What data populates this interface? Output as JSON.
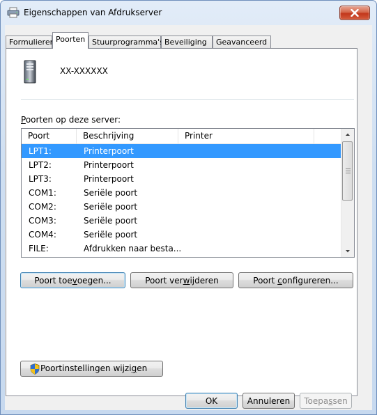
{
  "window": {
    "title": "Eigenschappen van Afdrukserver",
    "close_icon": "close-icon"
  },
  "tabs": [
    {
      "label": "Formulieren",
      "active": false
    },
    {
      "label": "Poorten",
      "active": true
    },
    {
      "label": "Stuurprogramma's",
      "active": false
    },
    {
      "label": "Beveiliging",
      "active": false
    },
    {
      "label": "Geavanceerd",
      "active": false
    }
  ],
  "server": {
    "name": "XX-XXXXXX",
    "icon": "server-icon"
  },
  "ports": {
    "label_pre": "",
    "label_underlined": "P",
    "label_post": "oorten op deze server:",
    "columns": [
      "Poort",
      "Beschrijving",
      "Printer"
    ],
    "rows": [
      {
        "port": "LPT1:",
        "description": "Printerpoort",
        "printer": "",
        "selected": true
      },
      {
        "port": "LPT2:",
        "description": "Printerpoort",
        "printer": "",
        "selected": false
      },
      {
        "port": "LPT3:",
        "description": "Printerpoort",
        "printer": "",
        "selected": false
      },
      {
        "port": "COM1:",
        "description": "Seriële poort",
        "printer": "",
        "selected": false
      },
      {
        "port": "COM2:",
        "description": "Seriële poort",
        "printer": "",
        "selected": false
      },
      {
        "port": "COM3:",
        "description": "Seriële poort",
        "printer": "",
        "selected": false
      },
      {
        "port": "COM4:",
        "description": "Seriële poort",
        "printer": "",
        "selected": false
      },
      {
        "port": "FILE:",
        "description": "Afdrukken naar besta...",
        "printer": "",
        "selected": false
      }
    ]
  },
  "buttons": {
    "add_pre": "Poort toe",
    "add_u": "v",
    "add_post": "oegen...",
    "delete_pre": "Poort ver",
    "delete_u": "w",
    "delete_post": "ijderen",
    "configure_pre": "Poort ",
    "configure_u": "c",
    "configure_post": "onfigureren...",
    "change_settings_pre": "Poortinstellingen wijzi",
    "change_settings_u": "g",
    "change_settings_post": "en",
    "ok": "OK",
    "cancel": "Annuleren",
    "apply_pre": "Toepa",
    "apply_u": "s",
    "apply_post": "sen"
  },
  "colors": {
    "selection": "#3399ff",
    "title_bar": "#cfdff1",
    "close_button": "#c2371c"
  }
}
